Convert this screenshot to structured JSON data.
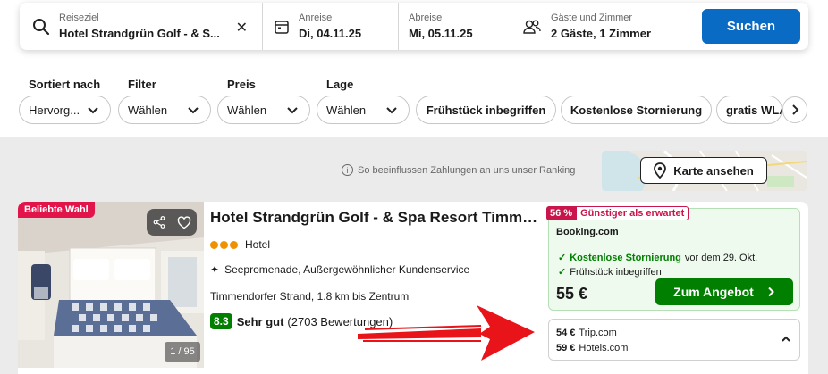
{
  "search": {
    "destination_label": "Reiseziel",
    "destination_value": "Hotel Strandgrün Golf - & S...",
    "checkin_label": "Anreise",
    "checkin_value": "Di, 04.11.25",
    "checkout_label": "Abreise",
    "checkout_value": "Mi, 05.11.25",
    "guests_label": "Gäste und Zimmer",
    "guests_value": "2 Gäste, 1 Zimmer",
    "clear_symbol": "✕",
    "button_label": "Suchen"
  },
  "filters": {
    "sort_label": "Sortiert nach",
    "sort_value": "Hervorg...",
    "filter_label": "Filter",
    "filter_value": "Wählen",
    "price_label": "Preis",
    "price_value": "Wählen",
    "location_label": "Lage",
    "location_value": "Wählen",
    "chips": [
      "Frühstück inbegriffen",
      "Kostenlose Stornierung",
      "gratis WLAN"
    ]
  },
  "ranking_note": "So beeinflussen Zahlungen an uns unser Ranking",
  "map_button": "Karte ansehen",
  "hotel": {
    "badge": "Beliebte Wahl",
    "photo_count": "1 / 95",
    "name": "Hotel Strandgrün Golf - & Spa Resort Timmendorfer Strand",
    "star_count": 3,
    "type": "Hotel",
    "highlights": "Seepromenade, Außergewöhnlicher Kundenservice",
    "distance": "Timmendorfer Strand, 1.8 km bis Zentrum",
    "score": "8.3",
    "score_word": "Sehr gut",
    "reviews": "(2703 Bewertungen)"
  },
  "deal": {
    "discount": "56 %",
    "discount_text": "Günstiger als erwartet",
    "provider": "Booking.com",
    "perk1_strong": "Kostenlose Stornierung",
    "perk1_rest": "vor dem 29. Okt.",
    "perk2": "Frühstück inbegriffen",
    "price": "55 €",
    "button": "Zum Angebot"
  },
  "other_offers": [
    {
      "price": "54 €",
      "provider": "Trip.com"
    },
    {
      "price": "59 €",
      "provider": "Hotels.com"
    }
  ],
  "colors": {
    "primary": "#0a6bc4",
    "deal_green": "#007f00",
    "badge_red": "#e2154b",
    "annotation_arrow": "#e8141a"
  }
}
